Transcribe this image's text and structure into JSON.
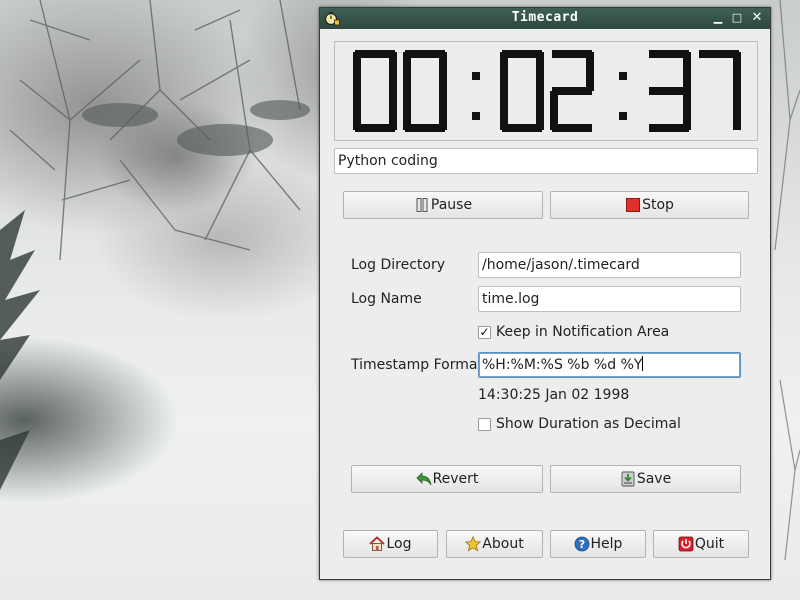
{
  "window": {
    "title": "Timecard"
  },
  "clock": {
    "hours": "00",
    "minutes": "02",
    "seconds": "37"
  },
  "task_field": {
    "value": "Python coding"
  },
  "controls": {
    "pause_label": "Pause",
    "stop_label": "Stop"
  },
  "settings": {
    "log_directory_label": "Log Directory",
    "log_directory_value": "/home/jason/.timecard",
    "log_name_label": "Log Name",
    "log_name_value": "time.log",
    "keep_in_notification_label": "Keep in Notification Area",
    "keep_in_notification_checked": true,
    "timestamp_format_label": "Timestamp Format",
    "timestamp_format_value": "%H:%M:%S %b %d %Y",
    "timestamp_preview": "14:30:25 Jan 02 1998",
    "show_duration_decimal_label": "Show Duration as Decimal",
    "show_duration_decimal_checked": false
  },
  "settings_buttons": {
    "revert_label": "Revert",
    "save_label": "Save"
  },
  "footer_buttons": {
    "log_label": "Log",
    "about_label": "About",
    "help_label": "Help",
    "quit_label": "Quit"
  },
  "colors": {
    "titlebar": "#34504a",
    "stop_icon": "#e0302a",
    "quit_icon": "#d8202a",
    "help_icon": "#2f6fc0",
    "about_icon": "#f1c232",
    "revert_icon": "#3a9a3a"
  }
}
